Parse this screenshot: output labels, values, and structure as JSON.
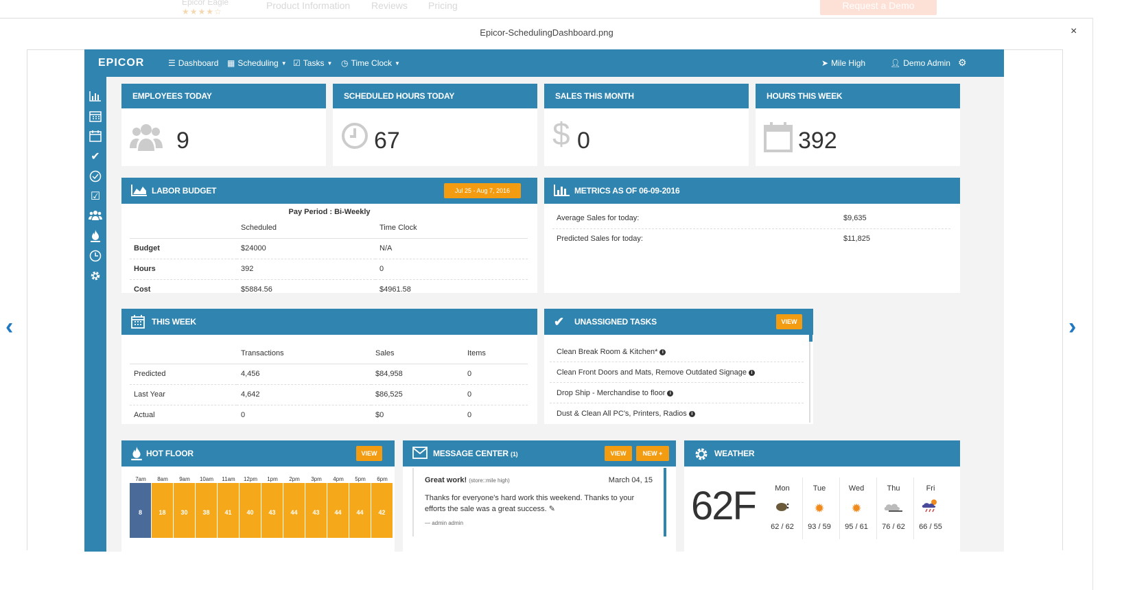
{
  "background_page": {
    "product_name": "Epicor Eagle",
    "nav": [
      "Product Information",
      "Reviews",
      "Pricing"
    ],
    "cta": "Request a Demo"
  },
  "lightbox": {
    "title": "Epicor-SchedulingDashboard.png",
    "close": "×"
  },
  "topbar": {
    "brand": "EPICOR",
    "nav": {
      "dashboard": "Dashboard",
      "scheduling": "Scheduling",
      "tasks": "Tasks",
      "time_clock": "Time Clock"
    },
    "location": "Mile High",
    "user": "Demo Admin"
  },
  "stats": [
    {
      "title": "EMPLOYEES TODAY",
      "value": "9",
      "icon": "users-icon"
    },
    {
      "title": "SCHEDULED HOURS TODAY",
      "value": "67",
      "icon": "clock-icon"
    },
    {
      "title": "SALES THIS MONTH",
      "value": "0",
      "icon": "dollar-icon"
    },
    {
      "title": "HOURS THIS WEEK",
      "value": "392",
      "icon": "calendar-icon"
    }
  ],
  "labor_budget": {
    "title": "LABOR BUDGET",
    "date_range": "Jul 25 - Aug 7, 2016",
    "pay_period": "Pay Period : Bi-Weekly",
    "columns": [
      "",
      "Scheduled",
      "Time Clock"
    ],
    "rows": [
      {
        "label": "Budget",
        "scheduled": "$24000",
        "time_clock": "N/A"
      },
      {
        "label": "Hours",
        "scheduled": "392",
        "time_clock": "0"
      },
      {
        "label": "Cost",
        "scheduled": "$5884.56",
        "time_clock": "$4961.58"
      }
    ]
  },
  "metrics": {
    "title": "METRICS AS OF 06-09-2016",
    "rows": [
      {
        "label": "Average Sales for today:",
        "value": "$9,635"
      },
      {
        "label": "Predicted Sales for today:",
        "value": "$11,825"
      }
    ]
  },
  "this_week": {
    "title": "THIS WEEK",
    "columns": [
      "",
      "Transactions",
      "Sales",
      "Items"
    ],
    "rows": [
      {
        "label": "Predicted",
        "transactions": "4,456",
        "sales": "$84,958",
        "items": "0"
      },
      {
        "label": "Last Year",
        "transactions": "4,642",
        "sales": "$86,525",
        "items": "0"
      },
      {
        "label": "Actual",
        "transactions": "0",
        "sales": "$0",
        "items": "0"
      }
    ]
  },
  "unassigned_tasks": {
    "title": "UNASSIGNED TASKS",
    "view": "VIEW",
    "items": [
      "Clean Break Room & Kitchen*",
      "Clean Front Doors and Mats, Remove Outdated Signage",
      "Drop Ship - Merchandise to floor",
      "Dust & Clean All PC's, Printers, Radios"
    ]
  },
  "hot_floor": {
    "title": "HOT FLOOR",
    "view": "VIEW",
    "hours": [
      "7am",
      "8am",
      "9am",
      "10am",
      "11am",
      "12pm",
      "1pm",
      "2pm",
      "3pm",
      "4pm",
      "5pm",
      "6pm"
    ],
    "values": [
      "8",
      "18",
      "30",
      "38",
      "41",
      "40",
      "43",
      "44",
      "43",
      "44",
      "44",
      "42"
    ]
  },
  "message_center": {
    "title": "MESSAGE CENTER",
    "count": "(1)",
    "view": "VIEW",
    "new": "NEW +",
    "message": {
      "title": "Great work!",
      "source": "(store::mile high)",
      "date": "March 04, 15",
      "body": "Thanks for everyone's hard work this weekend. Thanks to your efforts the sale was a great success.",
      "author": "— admin admin"
    }
  },
  "weather": {
    "title": "WEATHER",
    "current": "62F",
    "days": [
      {
        "day": "Mon",
        "temps": "62 / 62",
        "icon": "rain-icon"
      },
      {
        "day": "Tue",
        "temps": "93 / 59",
        "icon": "sun-icon"
      },
      {
        "day": "Wed",
        "temps": "95 / 61",
        "icon": "sun-icon"
      },
      {
        "day": "Thu",
        "temps": "76 / 62",
        "icon": "cloud-icon"
      },
      {
        "day": "Fri",
        "temps": "66 / 55",
        "icon": "storm-icon"
      }
    ]
  },
  "colors": {
    "primary": "#3085b0",
    "accent": "#f39c12",
    "hotfloor_cell": "#f5a81a",
    "hotfloor_current": "#4a6a99"
  }
}
